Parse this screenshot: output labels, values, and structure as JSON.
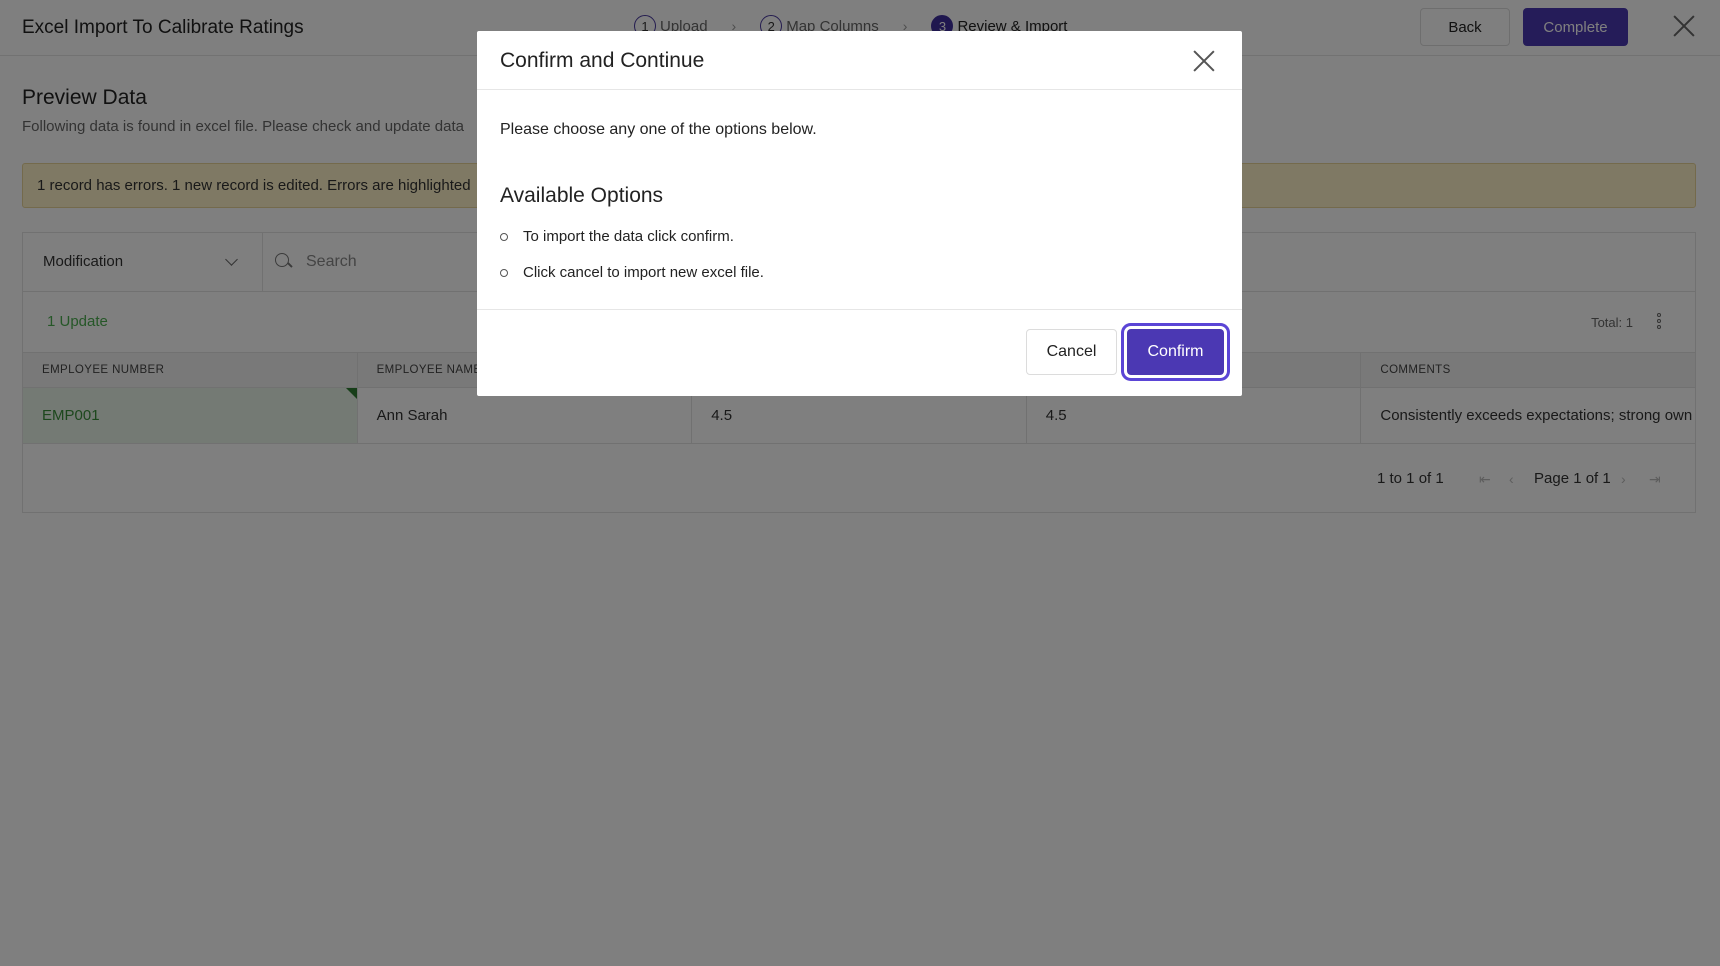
{
  "header": {
    "title": "Excel Import To Calibrate Ratings",
    "steps": [
      {
        "num": "1",
        "label": "Upload"
      },
      {
        "num": "2",
        "label": "Map Columns"
      },
      {
        "num": "3",
        "label": "Review & Import"
      }
    ],
    "back_label": "Back",
    "complete_label": "Complete"
  },
  "preview": {
    "title": "Preview Data",
    "subtitle": "Following data is found in excel file. Please check and update data",
    "banner": "1 record has errors. 1 new record is edited. Errors are highlighted"
  },
  "filters": {
    "modification_selected": "Modification",
    "search_placeholder": "Search"
  },
  "grid": {
    "update_label": "1 Update",
    "total_label": "Total: 1",
    "columns": [
      "EMPLOYEE NUMBER",
      "EMPLOYEE NAME",
      "",
      "",
      "COMMENTS"
    ],
    "rows": [
      {
        "cells": [
          "EMP001",
          "Ann Sarah",
          "4.5",
          "4.5",
          "Consistently exceeds expectations; strong own"
        ]
      }
    ]
  },
  "pager": {
    "range": "1 to 1 of 1",
    "page": "Page 1 of 1",
    "first": "⇤",
    "prev": "‹",
    "next": "›",
    "last": "⇥"
  },
  "modal": {
    "title": "Confirm and Continue",
    "message": "Please choose any one of the options below.",
    "options_title": "Available Options",
    "options": [
      "To import the data click confirm.",
      "Click cancel to import new excel file."
    ],
    "cancel_label": "Cancel",
    "confirm_label": "Confirm"
  },
  "colors": {
    "accent": "#4b38b3",
    "success": "#4caf50",
    "warning_bg": "#fff3c9"
  }
}
